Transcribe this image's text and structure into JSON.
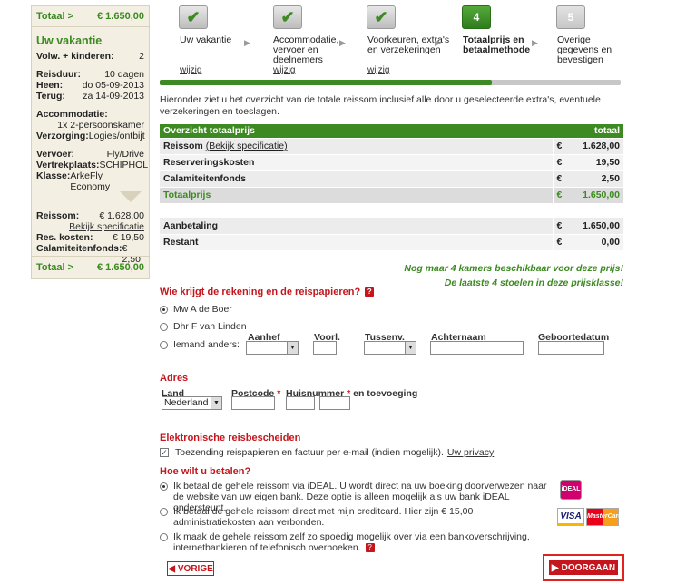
{
  "sidebar": {
    "total_label": "Totaal >",
    "total_value": "€ 1.650,00",
    "title": "Uw vakantie",
    "travellers_label": "Volw. + kinderen:",
    "travellers_value": "2",
    "duration_label": "Reisduur:",
    "duration_value": "10 dagen",
    "out_label": "Heen:",
    "out_value": "do 05-09-2013",
    "back_label": "Terug:",
    "back_value": "za 14-09-2013",
    "accommodation_label": "Accommodatie:",
    "accommodation_value": "1x 2-persoonskamer",
    "board_label": "Verzorging:",
    "board_value": "Logies/ontbijt",
    "transport_label": "Vervoer:",
    "transport_value": "Fly/Drive",
    "departure_label": "Vertrekplaats:",
    "departure_value": "SCHIPHOL",
    "class_label": "Klasse:",
    "class_value": "ArkeFly Economy",
    "trip_cost_label": "Reissom:",
    "trip_cost_value": "€ 1.628,00",
    "spec_link": "Bekijk specificatie",
    "res_cost_label": "Res. kosten:",
    "res_cost_value": "€ 19,50",
    "calamity_label": "Calamiteitenfonds:",
    "calamity_value": "€ 2,50"
  },
  "steps": [
    {
      "number": "",
      "label": "Uw vakantie",
      "state": "done",
      "edit": "wijzig"
    },
    {
      "number": "",
      "label": "Accommodatie, vervoer en deelnemers",
      "state": "done",
      "edit": "wijzig"
    },
    {
      "number": "",
      "label": "Voorkeuren, extra's en verzekeringen",
      "state": "done",
      "edit": "wijzig"
    },
    {
      "number": "4",
      "label": "Totaalprijs en betaalmethode",
      "state": "active",
      "edit": ""
    },
    {
      "number": "5",
      "label": "Overige gegevens en bevestigen",
      "state": "future",
      "edit": ""
    }
  ],
  "progress_fraction": 0.72,
  "intro": "Hieronder ziet u het overzicht van de totale reissom inclusief alle door u geselecteerde extra's, eventuele verzekeringen en toeslagen.",
  "overview": {
    "header_left": "Overzicht totaalprijs",
    "header_right": "totaal",
    "currency": "€",
    "rows": [
      {
        "label": "Reissom",
        "link": "(Bekijk specificatie)",
        "amount": "1.628,00"
      },
      {
        "label": "Reserveringskosten",
        "link": "",
        "amount": "19,50"
      },
      {
        "label": "Calamiteitenfonds",
        "link": "",
        "amount": "2,50"
      }
    ],
    "total_label": "Totaalprijs",
    "total_amount": "1.650,00"
  },
  "payment_table": {
    "deposit_label": "Aanbetaling",
    "deposit_amount": "1.650,00",
    "remainder_label": "Restant",
    "remainder_amount": "0,00",
    "currency": "€"
  },
  "notices": {
    "rooms": "Nog maar 4 kamers beschikbaar voor deze prijs!",
    "seats": "De laatste 4 stoelen in deze prijsklasse!"
  },
  "invoice": {
    "title": "Wie krijgt de rekening en de reispapieren?",
    "help": "?",
    "options": [
      "Mw A de Boer",
      "Dhr F van Linden",
      "Iemand anders:"
    ],
    "selected": 0,
    "fields": {
      "salutation": "Aanhef",
      "initials": "Voorl.",
      "infix": "Tussenv.",
      "lastname": "Achternaam",
      "birthdate": "Geboortedatum"
    }
  },
  "address": {
    "title": "Adres",
    "country_label": "Land",
    "country_value": "Nederland",
    "postcode_label": "Postcode",
    "house_label": "Huisnummer",
    "addition_label": "en toevoeging",
    "required_mark": "*"
  },
  "edocs": {
    "title": "Elektronische reisbescheiden",
    "checkbox_label": "Toezending reispapieren en factuur per e-mail (indien mogelijk).",
    "privacy_link": "Uw privacy",
    "checked": true
  },
  "payment": {
    "title": "Hoe wilt u betalen?",
    "options": [
      "Ik betaal de gehele reissom via iDEAL. U wordt direct na uw boeking doorverwezen naar de website van uw eigen bank. Deze optie is alleen mogelijk als uw bank iDEAL ondersteunt.",
      "Ik betaal de gehele reissom direct met mijn creditcard. Hier zijn € 15,00 administratiekosten aan verbonden.",
      "Ik maak de gehele reissom zelf zo spoedig mogelijk over via een bankoverschrijving, internetbankieren of telefonisch overboeken."
    ],
    "selected": 0,
    "ideal_logo": "iDEAL",
    "visa_logo": "VISA",
    "mastercard_logo": "MasterCard"
  },
  "buttons": {
    "back": "VORIGE",
    "next": "DOORGAAN"
  },
  "colors": {
    "green": "#3c8a21",
    "red": "#c4161c"
  }
}
